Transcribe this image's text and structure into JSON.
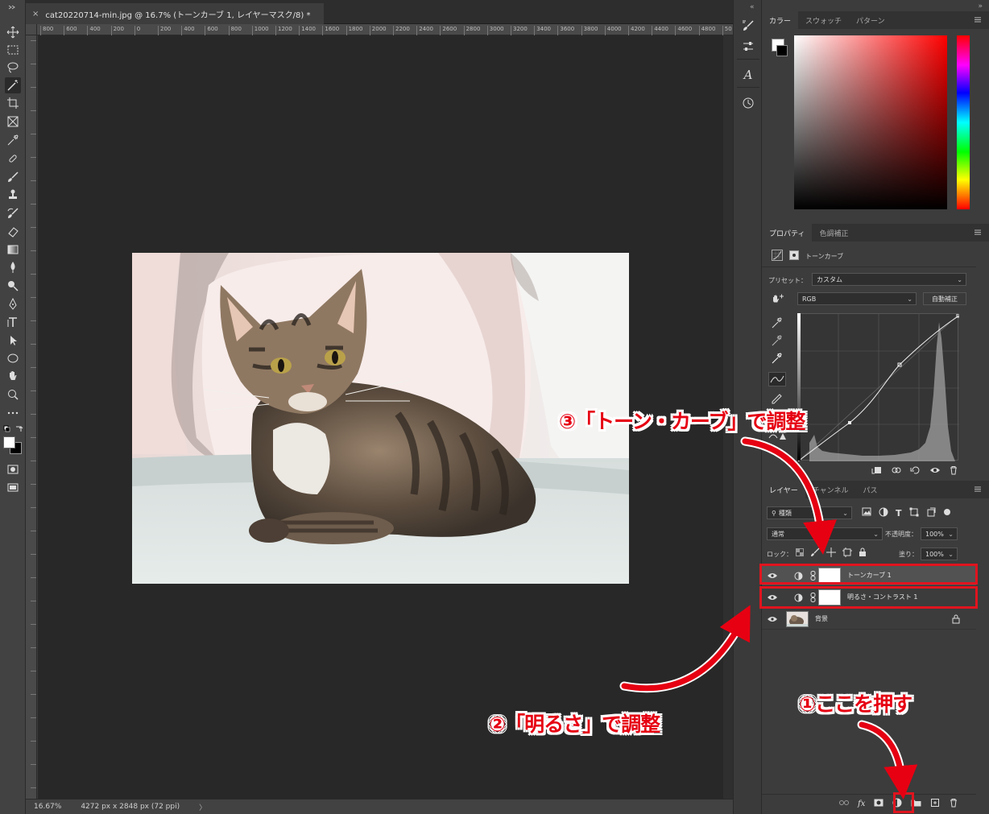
{
  "document": {
    "tab_title": "cat20220714-min.jpg @ 16.7% (トーンカーブ 1, レイヤーマスク/8) *",
    "ruler_marks": [
      "800",
      "600",
      "400",
      "200",
      "0",
      "200",
      "400",
      "600",
      "800",
      "1000",
      "1200",
      "1400",
      "1600",
      "1800",
      "2000",
      "2200",
      "2400",
      "2600",
      "2800",
      "3000",
      "3200",
      "3400",
      "3600",
      "3800",
      "4000",
      "4200",
      "4400",
      "4600",
      "4800",
      "50"
    ],
    "zoom": "16.67%",
    "dimensions": "4272 px x 2848 px (72 ppi)"
  },
  "panels": {
    "color": {
      "tabs": [
        "カラー",
        "スウォッチ",
        "パターン"
      ]
    },
    "properties": {
      "tabs": [
        "プロパティ",
        "色調補正"
      ],
      "adjustment_name": "トーンカーブ",
      "preset_label": "プリセット：",
      "preset_value": "カスタム",
      "channel_value": "RGB",
      "auto_button": "自動補正"
    },
    "layers": {
      "tabs": [
        "レイヤー",
        "チャンネル",
        "パス"
      ],
      "filter_value": "種類",
      "blend_mode": "通常",
      "opacity_label": "不透明度：",
      "opacity_value": "100%",
      "lock_label": "ロック：",
      "fill_label": "塗り：",
      "fill_value": "100%",
      "items": [
        {
          "name": "トーンカーブ 1"
        },
        {
          "name": "明るさ・コントラスト 1"
        },
        {
          "name": "背景"
        }
      ]
    }
  },
  "annotations": {
    "step1": "①ここを押す",
    "step2": "②「明るさ」で調整",
    "step3": "③「トーン・カーブ」で調整"
  },
  "colors": {
    "annotation_red": "#e60012",
    "highlight_border": "#e0141e"
  }
}
